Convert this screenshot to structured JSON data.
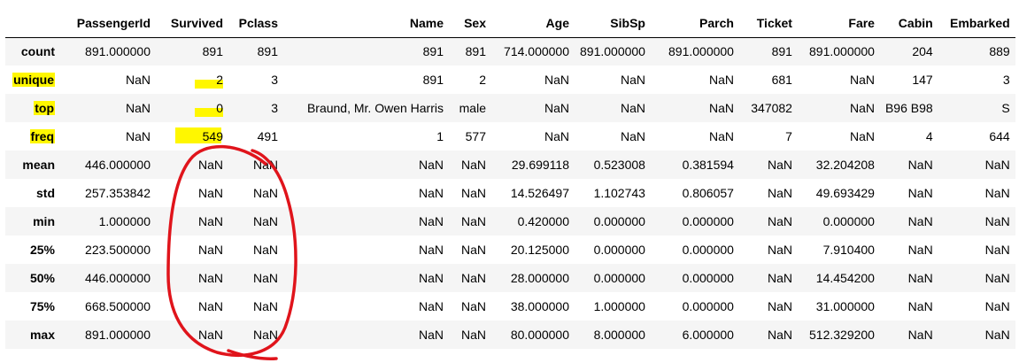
{
  "columns": [
    "",
    "PassengerId",
    "Survived",
    "Pclass",
    "Name",
    "Sex",
    "Age",
    "SibSp",
    "Parch",
    "Ticket",
    "Fare",
    "Cabin",
    "Embarked"
  ],
  "rows": [
    {
      "label": "count",
      "highlight": false,
      "cells": [
        "891.000000",
        "891",
        "891",
        "891",
        "891",
        "714.000000",
        "891.000000",
        "891.000000",
        "891",
        "891.000000",
        "204",
        "889"
      ]
    },
    {
      "label": "unique",
      "highlight": true,
      "cells": [
        "NaN",
        "2",
        "3",
        "891",
        "2",
        "NaN",
        "NaN",
        "NaN",
        "681",
        "NaN",
        "147",
        "3"
      ]
    },
    {
      "label": "top",
      "highlight": true,
      "cells": [
        "NaN",
        "0",
        "3",
        "Braund, Mr. Owen Harris",
        "male",
        "NaN",
        "NaN",
        "NaN",
        "347082",
        "NaN",
        "B96 B98",
        "S"
      ]
    },
    {
      "label": "freq",
      "highlight": true,
      "cells": [
        "NaN",
        "549",
        "491",
        "1",
        "577",
        "NaN",
        "NaN",
        "NaN",
        "7",
        "NaN",
        "4",
        "644"
      ]
    },
    {
      "label": "mean",
      "highlight": false,
      "cells": [
        "446.000000",
        "NaN",
        "NaN",
        "NaN",
        "NaN",
        "29.699118",
        "0.523008",
        "0.381594",
        "NaN",
        "32.204208",
        "NaN",
        "NaN"
      ]
    },
    {
      "label": "std",
      "highlight": false,
      "cells": [
        "257.353842",
        "NaN",
        "NaN",
        "NaN",
        "NaN",
        "14.526497",
        "1.102743",
        "0.806057",
        "NaN",
        "49.693429",
        "NaN",
        "NaN"
      ]
    },
    {
      "label": "min",
      "highlight": false,
      "cells": [
        "1.000000",
        "NaN",
        "NaN",
        "NaN",
        "NaN",
        "0.420000",
        "0.000000",
        "0.000000",
        "NaN",
        "0.000000",
        "NaN",
        "NaN"
      ]
    },
    {
      "label": "25%",
      "highlight": false,
      "cells": [
        "223.500000",
        "NaN",
        "NaN",
        "NaN",
        "NaN",
        "20.125000",
        "0.000000",
        "0.000000",
        "NaN",
        "7.910400",
        "NaN",
        "NaN"
      ]
    },
    {
      "label": "50%",
      "highlight": false,
      "cells": [
        "446.000000",
        "NaN",
        "NaN",
        "NaN",
        "NaN",
        "28.000000",
        "0.000000",
        "0.000000",
        "NaN",
        "14.454200",
        "NaN",
        "NaN"
      ]
    },
    {
      "label": "75%",
      "highlight": false,
      "cells": [
        "668.500000",
        "NaN",
        "NaN",
        "NaN",
        "NaN",
        "38.000000",
        "1.000000",
        "0.000000",
        "NaN",
        "31.000000",
        "NaN",
        "NaN"
      ]
    },
    {
      "label": "max",
      "highlight": false,
      "cells": [
        "891.000000",
        "NaN",
        "NaN",
        "NaN",
        "NaN",
        "80.000000",
        "8.000000",
        "6.000000",
        "NaN",
        "512.329200",
        "NaN",
        "NaN"
      ]
    }
  ],
  "annotations": {
    "highlight_color": "#fff700",
    "circle_color": "#e0141b",
    "highlighted_survived_rows": [
      "unique",
      "top",
      "freq"
    ]
  }
}
